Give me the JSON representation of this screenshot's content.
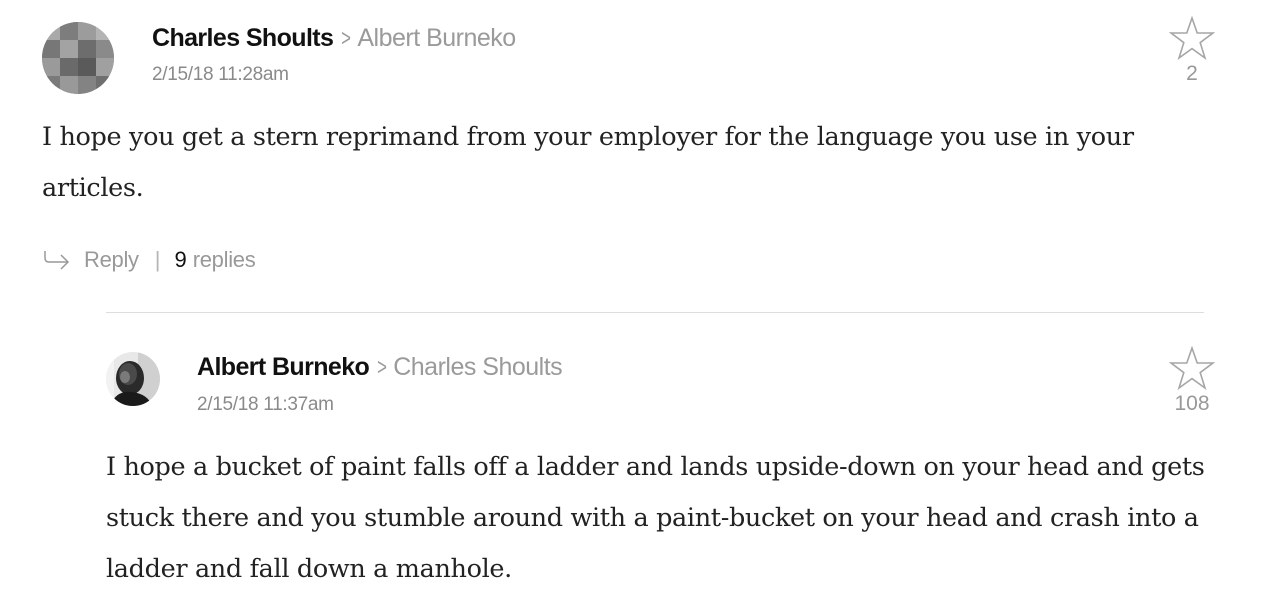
{
  "comments": [
    {
      "author": "Charles Shoults",
      "recipient": "Albert Burneko",
      "timestamp": "2/15/18 11:28am",
      "stars": "2",
      "body": "I hope you get a stern reprimand from your employer for the language you use in your articles.",
      "reply_label": "Reply",
      "replies_count": "9",
      "replies_label": "replies"
    },
    {
      "author": "Albert Burneko",
      "recipient": "Charles Shoults",
      "timestamp": "2/15/18 11:37am",
      "stars": "108",
      "body": "I hope a bucket of paint falls off a ladder and lands upside-down on your head and gets stuck there and you stumble around with a paint-bucket on your head and crash into a ladder and fall down a manhole."
    }
  ],
  "colors": {
    "author": "#111111",
    "muted": "#999999",
    "body_text": "#222222",
    "divider": "#dddddd"
  },
  "icons": {
    "star": "star-icon",
    "reply": "reply-arrow-icon",
    "reply_separator": "|"
  }
}
